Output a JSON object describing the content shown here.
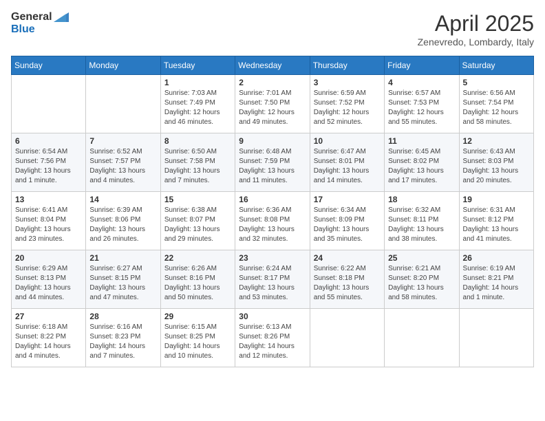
{
  "header": {
    "logo_general": "General",
    "logo_blue": "Blue",
    "month_year": "April 2025",
    "location": "Zenevredo, Lombardy, Italy"
  },
  "weekdays": [
    "Sunday",
    "Monday",
    "Tuesday",
    "Wednesday",
    "Thursday",
    "Friday",
    "Saturday"
  ],
  "weeks": [
    [
      {
        "day": "",
        "info": ""
      },
      {
        "day": "",
        "info": ""
      },
      {
        "day": "1",
        "info": "Sunrise: 7:03 AM\nSunset: 7:49 PM\nDaylight: 12 hours and 46 minutes."
      },
      {
        "day": "2",
        "info": "Sunrise: 7:01 AM\nSunset: 7:50 PM\nDaylight: 12 hours and 49 minutes."
      },
      {
        "day": "3",
        "info": "Sunrise: 6:59 AM\nSunset: 7:52 PM\nDaylight: 12 hours and 52 minutes."
      },
      {
        "day": "4",
        "info": "Sunrise: 6:57 AM\nSunset: 7:53 PM\nDaylight: 12 hours and 55 minutes."
      },
      {
        "day": "5",
        "info": "Sunrise: 6:56 AM\nSunset: 7:54 PM\nDaylight: 12 hours and 58 minutes."
      }
    ],
    [
      {
        "day": "6",
        "info": "Sunrise: 6:54 AM\nSunset: 7:56 PM\nDaylight: 13 hours and 1 minute."
      },
      {
        "day": "7",
        "info": "Sunrise: 6:52 AM\nSunset: 7:57 PM\nDaylight: 13 hours and 4 minutes."
      },
      {
        "day": "8",
        "info": "Sunrise: 6:50 AM\nSunset: 7:58 PM\nDaylight: 13 hours and 7 minutes."
      },
      {
        "day": "9",
        "info": "Sunrise: 6:48 AM\nSunset: 7:59 PM\nDaylight: 13 hours and 11 minutes."
      },
      {
        "day": "10",
        "info": "Sunrise: 6:47 AM\nSunset: 8:01 PM\nDaylight: 13 hours and 14 minutes."
      },
      {
        "day": "11",
        "info": "Sunrise: 6:45 AM\nSunset: 8:02 PM\nDaylight: 13 hours and 17 minutes."
      },
      {
        "day": "12",
        "info": "Sunrise: 6:43 AM\nSunset: 8:03 PM\nDaylight: 13 hours and 20 minutes."
      }
    ],
    [
      {
        "day": "13",
        "info": "Sunrise: 6:41 AM\nSunset: 8:04 PM\nDaylight: 13 hours and 23 minutes."
      },
      {
        "day": "14",
        "info": "Sunrise: 6:39 AM\nSunset: 8:06 PM\nDaylight: 13 hours and 26 minutes."
      },
      {
        "day": "15",
        "info": "Sunrise: 6:38 AM\nSunset: 8:07 PM\nDaylight: 13 hours and 29 minutes."
      },
      {
        "day": "16",
        "info": "Sunrise: 6:36 AM\nSunset: 8:08 PM\nDaylight: 13 hours and 32 minutes."
      },
      {
        "day": "17",
        "info": "Sunrise: 6:34 AM\nSunset: 8:09 PM\nDaylight: 13 hours and 35 minutes."
      },
      {
        "day": "18",
        "info": "Sunrise: 6:32 AM\nSunset: 8:11 PM\nDaylight: 13 hours and 38 minutes."
      },
      {
        "day": "19",
        "info": "Sunrise: 6:31 AM\nSunset: 8:12 PM\nDaylight: 13 hours and 41 minutes."
      }
    ],
    [
      {
        "day": "20",
        "info": "Sunrise: 6:29 AM\nSunset: 8:13 PM\nDaylight: 13 hours and 44 minutes."
      },
      {
        "day": "21",
        "info": "Sunrise: 6:27 AM\nSunset: 8:15 PM\nDaylight: 13 hours and 47 minutes."
      },
      {
        "day": "22",
        "info": "Sunrise: 6:26 AM\nSunset: 8:16 PM\nDaylight: 13 hours and 50 minutes."
      },
      {
        "day": "23",
        "info": "Sunrise: 6:24 AM\nSunset: 8:17 PM\nDaylight: 13 hours and 53 minutes."
      },
      {
        "day": "24",
        "info": "Sunrise: 6:22 AM\nSunset: 8:18 PM\nDaylight: 13 hours and 55 minutes."
      },
      {
        "day": "25",
        "info": "Sunrise: 6:21 AM\nSunset: 8:20 PM\nDaylight: 13 hours and 58 minutes."
      },
      {
        "day": "26",
        "info": "Sunrise: 6:19 AM\nSunset: 8:21 PM\nDaylight: 14 hours and 1 minute."
      }
    ],
    [
      {
        "day": "27",
        "info": "Sunrise: 6:18 AM\nSunset: 8:22 PM\nDaylight: 14 hours and 4 minutes."
      },
      {
        "day": "28",
        "info": "Sunrise: 6:16 AM\nSunset: 8:23 PM\nDaylight: 14 hours and 7 minutes."
      },
      {
        "day": "29",
        "info": "Sunrise: 6:15 AM\nSunset: 8:25 PM\nDaylight: 14 hours and 10 minutes."
      },
      {
        "day": "30",
        "info": "Sunrise: 6:13 AM\nSunset: 8:26 PM\nDaylight: 14 hours and 12 minutes."
      },
      {
        "day": "",
        "info": ""
      },
      {
        "day": "",
        "info": ""
      },
      {
        "day": "",
        "info": ""
      }
    ]
  ]
}
